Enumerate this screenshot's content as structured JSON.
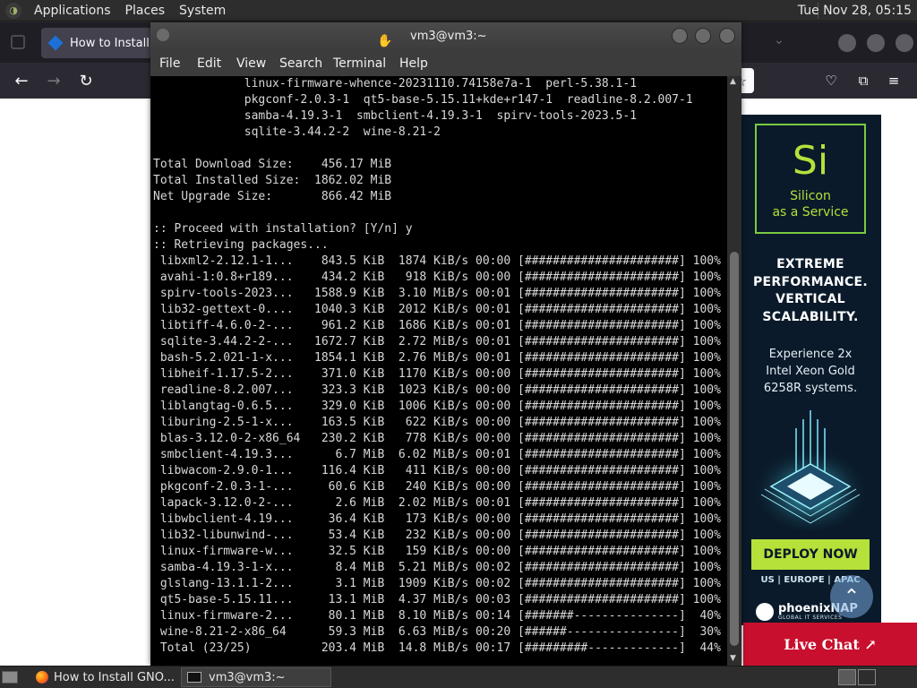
{
  "top_panel": {
    "menus": [
      "Applications",
      "Places",
      "System"
    ],
    "clock": "Tue Nov 28, 05:15"
  },
  "browser": {
    "tab_title": "How to Install G"
  },
  "ad": {
    "symbol": "Si",
    "subtitle_line1": "Silicon",
    "subtitle_line2": "as a Service",
    "headline": [
      "EXTREME",
      "PERFORMANCE.",
      "VERTICAL",
      "SCALABILITY."
    ],
    "sub": [
      "Experience 2x",
      "Intel Xeon Gold",
      "6258R systems."
    ],
    "cta": "DEPLOY NOW",
    "regions": "US | EUROPE | APAC",
    "brand": "phoenixNAP",
    "brand_tag": "GLOBAL IT SERVICES",
    "accent": "#b6e03a"
  },
  "live_chat": {
    "label": "Live Chat ↗"
  },
  "terminal": {
    "title": "vm3@vm3:~",
    "menu": [
      "File",
      "Edit",
      "View",
      "Search",
      "Terminal",
      "Help"
    ],
    "lines": [
      "             linux-firmware-whence-20231110.74158e7a-1  perl-5.38.1-1",
      "             pkgconf-2.0.3-1  qt5-base-5.15.11+kde+r147-1  readline-8.2.007-1",
      "             samba-4.19.3-1  smbclient-4.19.3-1  spirv-tools-2023.5-1",
      "             sqlite-3.44.2-2  wine-8.21-2",
      "",
      "Total Download Size:    456.17 MiB",
      "Total Installed Size:  1862.02 MiB",
      "Net Upgrade Size:       866.42 MiB",
      "",
      ":: Proceed with installation? [Y/n] y",
      ":: Retrieving packages...",
      " libxml2-2.12.1-1...    843.5 KiB  1874 KiB/s 00:00 [######################] 100%",
      " avahi-1:0.8+r189...    434.2 KiB   918 KiB/s 00:00 [######################] 100%",
      " spirv-tools-2023...   1588.9 KiB  3.10 MiB/s 00:01 [######################] 100%",
      " lib32-gettext-0....   1040.3 KiB  2012 KiB/s 00:01 [######################] 100%",
      " libtiff-4.6.0-2-...    961.2 KiB  1686 KiB/s 00:01 [######################] 100%",
      " sqlite-3.44.2-2-...   1672.7 KiB  2.72 MiB/s 00:01 [######################] 100%",
      " bash-5.2.021-1-x...   1854.1 KiB  2.76 MiB/s 00:01 [######################] 100%",
      " libheif-1.17.5-2...    371.0 KiB  1170 KiB/s 00:00 [######################] 100%",
      " readline-8.2.007...    323.3 KiB  1023 KiB/s 00:00 [######################] 100%",
      " liblangtag-0.6.5...    329.0 KiB  1006 KiB/s 00:00 [######################] 100%",
      " liburing-2.5-1-x...    163.5 KiB   622 KiB/s 00:00 [######################] 100%",
      " blas-3.12.0-2-x86_64   230.2 KiB   778 KiB/s 00:00 [######################] 100%",
      " smbclient-4.19.3...      6.7 MiB  6.02 MiB/s 00:01 [######################] 100%",
      " libwacom-2.9.0-1...    116.4 KiB   411 KiB/s 00:00 [######################] 100%",
      " pkgconf-2.0.3-1-...     60.6 KiB   240 KiB/s 00:00 [######################] 100%",
      " lapack-3.12.0-2-...      2.6 MiB  2.02 MiB/s 00:01 [######################] 100%",
      " libwbclient-4.19...     36.4 KiB   173 KiB/s 00:00 [######################] 100%",
      " lib32-libunwind-...     53.4 KiB   232 KiB/s 00:00 [######################] 100%",
      " linux-firmware-w...     32.5 KiB   159 KiB/s 00:00 [######################] 100%",
      " samba-4.19.3-1-x...      8.4 MiB  5.21 MiB/s 00:02 [######################] 100%",
      " glslang-13.1.1-2...      3.1 MiB  1909 KiB/s 00:02 [######################] 100%",
      " qt5-base-5.15.11...     13.1 MiB  4.37 MiB/s 00:03 [######################] 100%",
      " linux-firmware-2...     80.1 MiB  8.10 MiB/s 00:14 [#######---------------]  40%",
      " wine-8.21-2-x86_64      59.3 MiB  6.63 MiB/s 00:20 [######----------------]  30%",
      " Total (23/25)          203.4 MiB  14.8 MiB/s 00:17 [#########-------------]  44%"
    ]
  },
  "taskbar": {
    "tasks": [
      {
        "label": "How to Install GNO..."
      },
      {
        "label": "vm3@vm3:~"
      }
    ]
  }
}
